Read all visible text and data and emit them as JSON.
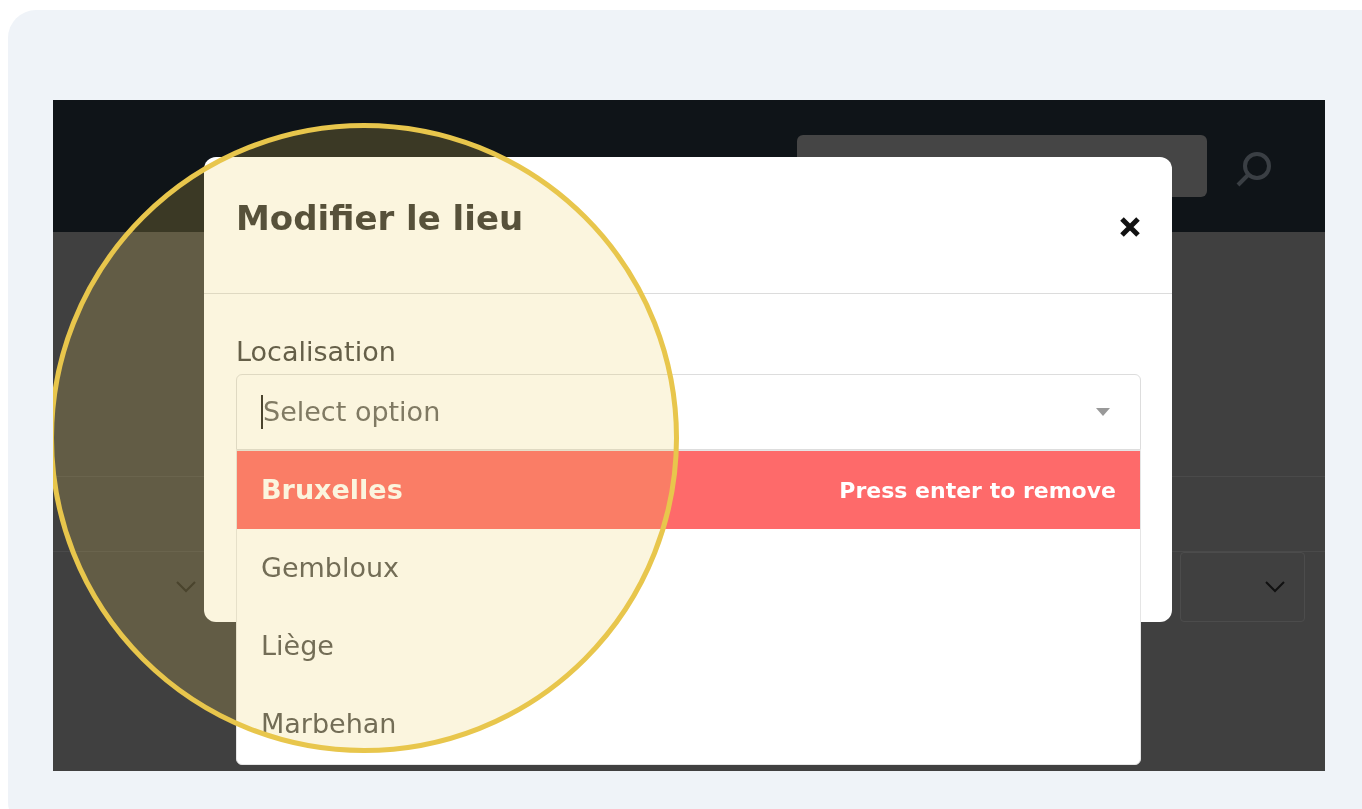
{
  "dialog": {
    "title": "Modifier le lieu"
  },
  "field": {
    "label": "Localisation",
    "placeholder": "Select option"
  },
  "options": [
    {
      "label": "Bruxelles",
      "selected": true
    },
    {
      "label": "Gembloux",
      "selected": false
    },
    {
      "label": "Liège",
      "selected": false
    },
    {
      "label": "Marbehan",
      "selected": false
    }
  ],
  "selected_hint": "Press enter to remove"
}
